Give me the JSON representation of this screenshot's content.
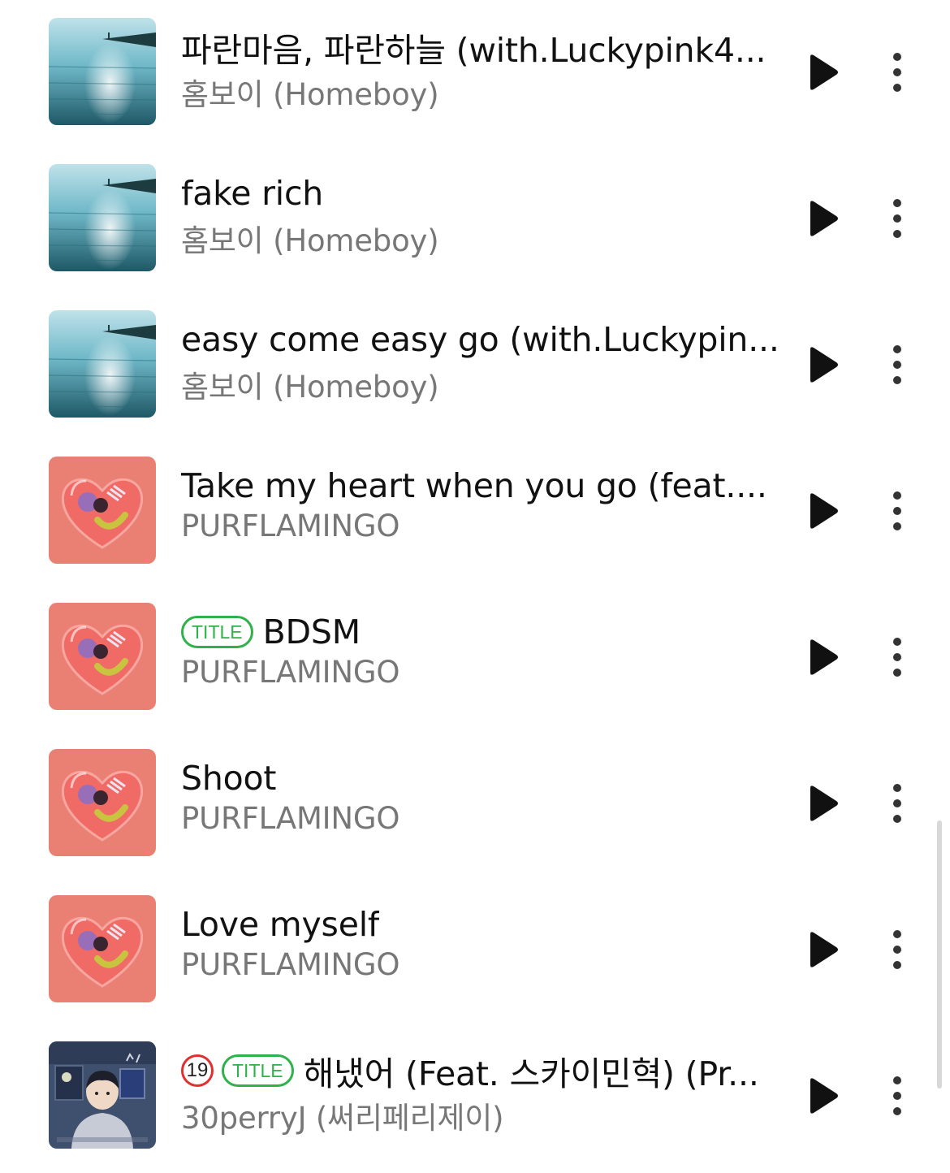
{
  "tracks": [
    {
      "title": "파란마음, 파란하늘 (with.Luckypink4...",
      "artist": "홈보이 (Homeboy)",
      "art": "sea-art",
      "title_badge": "",
      "age_badge": ""
    },
    {
      "title": "fake rich",
      "artist": "홈보이 (Homeboy)",
      "art": "sea-art",
      "title_badge": "",
      "age_badge": ""
    },
    {
      "title": "easy come easy go (with.Luckypin...",
      "artist": "홈보이 (Homeboy)",
      "art": "sea-art",
      "title_badge": "",
      "age_badge": ""
    },
    {
      "title": "Take my heart when you go (feat....",
      "artist": "PURFLAMINGO",
      "art": "heart-art",
      "title_badge": "",
      "age_badge": ""
    },
    {
      "title": "BDSM",
      "artist": "PURFLAMINGO",
      "art": "heart-art",
      "title_badge": "TITLE",
      "age_badge": ""
    },
    {
      "title": "Shoot",
      "artist": "PURFLAMINGO",
      "art": "heart-art",
      "title_badge": "",
      "age_badge": ""
    },
    {
      "title": "Love myself",
      "artist": "PURFLAMINGO",
      "art": "heart-art",
      "title_badge": "",
      "age_badge": ""
    },
    {
      "title": "해냈어 (Feat. 스카이민혁) (Pr...",
      "artist": "30perryJ (써리페리제이)",
      "art": "room-art",
      "title_badge": "TITLE",
      "age_badge": "19"
    }
  ],
  "icons": {
    "play": "play-icon",
    "more": "more-vertical-icon"
  },
  "colors": {
    "title_badge": "#2fb24b",
    "age_badge": "#e0302f",
    "artist_text": "#777777",
    "title_text": "#111111"
  }
}
